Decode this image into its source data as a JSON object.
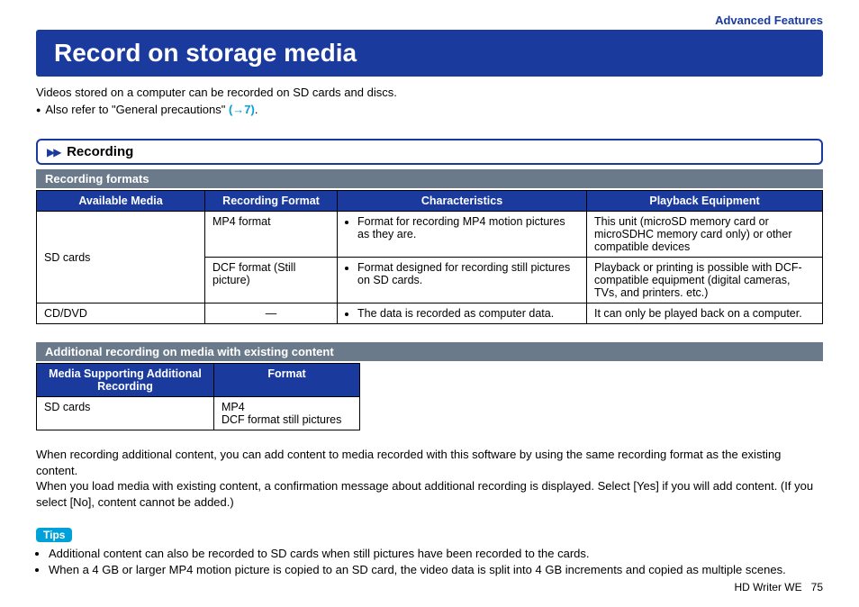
{
  "header": {
    "section_label": "Advanced Features"
  },
  "title": "Record on storage media",
  "intro": {
    "line1": "Videos stored on a computer can be recorded on SD cards and discs.",
    "line2_prefix": "Also refer to \"General precautions\" ",
    "line2_link": "(→7)",
    "line2_suffix": "."
  },
  "section1": {
    "title": "Recording",
    "sub1": "Recording formats",
    "table1": {
      "headers": [
        "Available Media",
        "Recording Format",
        "Characteristics",
        "Playback Equipment"
      ],
      "rows": [
        {
          "media": "SD cards",
          "rowspan": 2,
          "format": "MP4 format",
          "char": "Format for recording MP4 motion pictures as they are.",
          "playback": "This unit (microSD memory card or microSDHC memory card only) or other compatible devices"
        },
        {
          "format": "DCF format (Still picture)",
          "char": "Format designed for recording still pictures on SD cards.",
          "playback": "Playback or printing is possible with DCF-compatible equipment (digital cameras, TVs, and printers. etc.)"
        },
        {
          "media": "CD/DVD",
          "format": "—",
          "char": "The data is recorded as computer data.",
          "playback": "It can only be played back on a computer."
        }
      ]
    },
    "sub2": "Additional recording on media with existing content",
    "table2": {
      "headers": [
        "Media Supporting Additional Recording",
        "Format"
      ],
      "row": {
        "media": "SD cards",
        "format_line1": "MP4",
        "format_line2": "DCF format still pictures"
      }
    }
  },
  "paragraph": {
    "line1": "When recording additional content, you can add content to media recorded with this software by using the same recording format as the existing content.",
    "line2": "When you load media with existing content, a confirmation message about additional recording is displayed. Select [Yes] if you will add content. (If you select [No], content cannot be added.)"
  },
  "tips": {
    "label": "Tips",
    "items": [
      "Additional content can also be recorded to SD cards when still pictures have been recorded to the cards.",
      "When a 4 GB or larger MP4 motion picture is copied to an SD card, the video data is split into 4 GB increments and copied as multiple scenes."
    ]
  },
  "footer": {
    "product": "HD Writer WE",
    "page": "75"
  }
}
